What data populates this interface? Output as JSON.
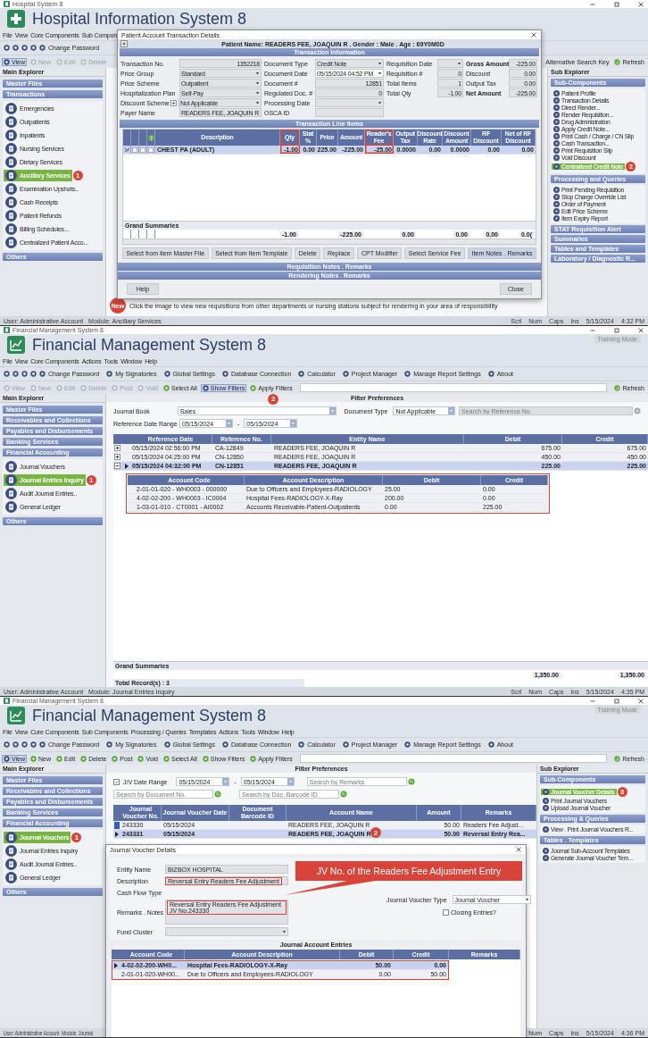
{
  "screens": [
    {
      "kind": "hospital",
      "window_title": "Hospital System 8",
      "app_title": "Hospital Information System 8",
      "menu": [
        "File",
        "View",
        "Core Components",
        "Sub Compon"
      ],
      "toolbar": [
        "Change Password"
      ],
      "actions": [
        {
          "label": "View",
          "selected": true,
          "disabled": false
        },
        {
          "label": "New",
          "selected": false,
          "disabled": true
        },
        {
          "label": "Edit",
          "selected": false,
          "disabled": true
        },
        {
          "label": "Delete",
          "selected": false,
          "disabled": true
        }
      ],
      "search_label": "Alternative Search Key",
      "refresh": "Refresh",
      "main_explorer": {
        "title": "Main Explorer",
        "sections": [
          {
            "label": "Master Files"
          },
          {
            "label": "Transactions",
            "items": [
              {
                "label": "Emergencies",
                "selected": false
              },
              {
                "label": "Outpatients",
                "selected": false
              },
              {
                "label": "Inpatients",
                "selected": false
              },
              {
                "label": "Nursing Services",
                "selected": false
              },
              {
                "label": "Dietary Services",
                "selected": false
              },
              {
                "label": "Ancillary Services",
                "selected": true,
                "badge": "1"
              },
              {
                "label": "Examination Upshots..",
                "selected": false
              },
              {
                "label": "Cash Receipts",
                "selected": false
              },
              {
                "label": "Patient Refunds",
                "selected": false
              },
              {
                "label": "Billing Schedules...",
                "selected": false
              },
              {
                "label": "Centralized Patient Acco...",
                "selected": false
              }
            ]
          },
          {
            "label": "Others"
          }
        ]
      },
      "sub_explorer": {
        "title": "Sub Explorer",
        "sections": [
          {
            "label": "Sub-Components",
            "items": [
              {
                "label": "Patient Profile",
                "selected": false
              },
              {
                "label": "Transaction Details",
                "selected": false
              },
              {
                "label": "Direct Render...",
                "selected": false
              },
              {
                "label": "Render Requisition...",
                "selected": false
              },
              {
                "label": "Drug Administration",
                "selected": false
              },
              {
                "label": "Apply Credit Note...",
                "selected": false
              },
              {
                "label": "Print Cash / Charge / CN Slip",
                "selected": false
              },
              {
                "label": "Cash Transaction...",
                "selected": false
              },
              {
                "label": "Print Requisition Slip",
                "selected": false
              },
              {
                "label": "Void Discount",
                "selected": false
              },
              {
                "label": "Centralized Credit Note",
                "selected": true,
                "badge": "2"
              }
            ]
          },
          {
            "label": "Processing and Queries",
            "items": [
              {
                "label": "Print Pending Requisition",
                "selected": false
              },
              {
                "label": "Stop Charge Override List",
                "selected": false
              },
              {
                "label": "Order of Payment",
                "selected": false
              },
              {
                "label": "Edit Price Scheme",
                "selected": false
              },
              {
                "label": "Item Expiry Report",
                "selected": false
              }
            ]
          },
          {
            "label": "STAT Requisition Alert"
          },
          {
            "label": "Summaries"
          },
          {
            "label": "Tables and Templates"
          },
          {
            "label": "Laboratory / Diagnostic R..."
          }
        ]
      },
      "notice": {
        "badge": "New",
        "text": "Click the image to view new requisitions from other departments or nursing stations subject for rendering in your area of responsibility"
      },
      "status": {
        "left": [
          "User: Administrative Account",
          "Module: Ancillary Services"
        ],
        "right": [
          "Scrl",
          "Num",
          "Caps",
          "Ins",
          "5/15/2024",
          "4:32 PM"
        ]
      },
      "dialog": {
        "title": "Patient Account Transaction Details",
        "patient": "Patient Name: READERS FEE, JOAQUIN R . Gender : Male . Age : 69Y0M0D",
        "info_title": "Transaction Information",
        "form": [
          [
            {
              "label": "Transaction No.",
              "value": "1352218",
              "kind": "number"
            },
            {
              "label": "Price Group",
              "value": "Standard",
              "kind": "dropdown"
            },
            {
              "label": "Price Scheme",
              "value": "Outpatient",
              "kind": "dropdown"
            },
            {
              "label": "Hospitalization Plan",
              "value": "Self-Pay",
              "kind": "dropdown"
            },
            {
              "label": "Discount Scheme",
              "value": "Not Applicable",
              "kind": "dropdown",
              "add_button": true
            },
            {
              "label": "Payer Name",
              "value": "READERS FEE, JOAQUIN R",
              "kind": "text"
            }
          ],
          [
            {
              "label": "Document Type",
              "value": "Credit Note",
              "kind": "dropdown"
            },
            {
              "label": "Document Date",
              "value": "05/15/2024 04:52 PM",
              "kind": "date"
            },
            {
              "label": "Document #",
              "value": "12851",
              "kind": "number"
            },
            {
              "label": "Regulated Doc. #",
              "value": "0",
              "kind": "number"
            },
            {
              "label": "Processing Date",
              "kind": "dropdown"
            },
            {
              "label": "OSCA ID",
              "kind": "text"
            }
          ],
          [
            {
              "label": "Requisition Date",
              "kind": "dropdown"
            },
            {
              "label": "Requisition #",
              "value": "0",
              "kind": "number"
            },
            {
              "label": "Total Items",
              "value": "1",
              "kind": "number"
            },
            {
              "label": "Total Qty",
              "value": "-1.00",
              "kind": "number"
            }
          ],
          [
            {
              "label": "Gross Amount",
              "value": "-225.00",
              "kind": "number",
              "bold": true
            },
            {
              "label": "Discount",
              "value": "0.00",
              "kind": "number",
              "bold": false
            },
            {
              "label": "Output Tax",
              "value": "0.00",
              "kind": "number",
              "bold": false
            },
            {
              "label": "Net Amount",
              "value": "-225.00",
              "kind": "number",
              "bold": true
            }
          ]
        ],
        "items_title": "Transaction Line Items",
        "grid": {
          "columns": [
            {
              "label": "Description"
            },
            {
              "label": "Qty",
              "highlighted": true
            },
            {
              "label": "Stat %",
              "highlighted": false
            },
            {
              "label": "Price",
              "highlighted": false
            },
            {
              "label": "Amount",
              "highlighted": false
            },
            {
              "label": "Reader's Fee",
              "highlighted": true
            },
            {
              "label": "Output Tax",
              "highlighted": false
            },
            {
              "label": "Discount Rate",
              "highlighted": false
            },
            {
              "label": "Discount Amount",
              "highlighted": false
            },
            {
              "label": "RF Discount",
              "highlighted": false
            },
            {
              "label": "Net of RF Discount",
              "highlighted": false
            }
          ],
          "rows": [
            {
              "checks": [
                false,
                false,
                false
              ],
              "cells": [
                "CHEST PA (ADULT)",
                "-1.00",
                "0.00",
                "225.00",
                "-225.00",
                "-25.00",
                "0.0000",
                "0.00",
                "0.0000",
                "0.00",
                "0.00"
              ]
            }
          ],
          "summary_label": "Grand Summaries",
          "summary_values": [
            "-1.00",
            "-225.00",
            "0.00",
            "0.00",
            "0.00",
            "0.0("
          ]
        },
        "buttons": [
          "Select from Item Master File",
          "Select from Item Template",
          "Delete",
          "Replace",
          "CPT Modifier",
          "Select Service Fee",
          "Item Notes . Remarks"
        ],
        "bars": [
          "Requisition Notes . Remarks",
          "Rendering Notes . Remarks"
        ],
        "help": "Help",
        "close": "Close"
      }
    },
    {
      "kind": "inquiry",
      "window_title": "Financial Management System 8",
      "app_title": "Financial Management System 8",
      "training_mode": "Training Mode",
      "menu": [
        "File",
        "View",
        "Core Components",
        "Actions",
        "Tools",
        "Window",
        "Help"
      ],
      "toolbar": [
        "Change Password",
        "My Signatories",
        "Global Settings",
        "Database Connection",
        "Calculator",
        "Project Manager",
        "Manage Report Settings",
        "About"
      ],
      "actions": [
        {
          "label": "View",
          "selected": false,
          "disabled": true
        },
        {
          "label": "New",
          "selected": false,
          "disabled": true
        },
        {
          "label": "Edit",
          "selected": false,
          "disabled": true
        },
        {
          "label": "Delete",
          "selected": false,
          "disabled": true
        },
        {
          "label": "Post",
          "selected": false,
          "disabled": true
        },
        {
          "label": "Void",
          "selected": false,
          "disabled": true
        },
        {
          "label": "Select All",
          "selected": false,
          "disabled": false
        },
        {
          "label": "Show Filters",
          "selected": true,
          "disabled": false
        },
        {
          "label": "Apply Filters",
          "selected": false,
          "disabled": false,
          "badge": "2"
        }
      ],
      "refresh": "Refresh",
      "main_explorer": {
        "title": "Main Explorer",
        "sections": [
          {
            "label": "Master Files"
          },
          {
            "label": "Receivables and Collections"
          },
          {
            "label": "Payables and Disbursements"
          },
          {
            "label": "Banking Services"
          },
          {
            "label": "Financial Accounting",
            "items": [
              {
                "label": "Journal Vouchers",
                "selected": false
              },
              {
                "label": "Journal Entries Inquiry",
                "selected": true,
                "badge": "1"
              },
              {
                "label": "Audit Journal Entries..",
                "selected": false
              },
              {
                "label": "General Ledger",
                "selected": false
              }
            ]
          },
          {
            "label": "Others"
          }
        ]
      },
      "filter": {
        "title": "Filter Preferences",
        "journal_book": {
          "label": "Journal Book",
          "value": "Sales"
        },
        "date_range": {
          "label": "Reference Date Range",
          "from": "05/15/2024",
          "separator": "-",
          "to": "05/15/2024"
        },
        "document_type": {
          "label": "Document Type",
          "value": "Not Applicable"
        },
        "search": {
          "placeholder": "Search by Reference No."
        }
      },
      "grid": {
        "columns": [
          {
            "label": "Reference Date"
          },
          {
            "label": "Reference No."
          },
          {
            "label": "Entity Name"
          },
          {
            "label": "Debit",
            "summary": "1,350.00"
          },
          {
            "label": "Credit",
            "summary": "1,350.00"
          }
        ],
        "rows": [
          {
            "cells": [
              "05/15/2024 02:56:00 PM",
              "CA-12849",
              "READERS FEE, JOAQUIN R",
              "675.00",
              "675.00"
            ],
            "selected": false,
            "expanded": false
          },
          {
            "cells": [
              "05/15/2024 04:25:00 PM",
              "CN-12850",
              "READERS FEE, JOAQUIN R",
              "450.00",
              "450.00"
            ],
            "selected": false,
            "expanded": false
          },
          {
            "cells": [
              "05/15/2024 04:32:00 PM",
              "CN-12851",
              "READERS FEE, JOAQUIN R",
              "225.00",
              "225.00"
            ],
            "selected": true,
            "expanded": true,
            "details": {
              "highlighted": true,
              "columns": [
                "Account Code",
                "Account Description",
                "Debit",
                "Credit"
              ],
              "rows": [
                [
                  "2-01-01-020 - WH0003 - 000000",
                  "Due to Officers and  Employees-RADIOLOGY",
                  "25.00",
                  "0.00"
                ],
                [
                  "4-02-02-200 - WH0003 - IC0004",
                  "Hospital  Fees-RADIOLOGY-X-Ray",
                  "200.00",
                  "0.00"
                ],
                [
                  "1-03-01-010 - CT0001 - AI0002",
                  "Accounts  Receivable-Patient-Outpatients",
                  "0.00",
                  "225.00"
                ]
              ]
            }
          }
        ],
        "summary_label": "Grand Summaries",
        "total": "Total Record(s) : 3"
      },
      "status": {
        "left": [
          "User: Administrative Account",
          "Module: Journal Entries Inquiry"
        ],
        "right": [
          "Scrl",
          "Num",
          "Caps",
          "Ins",
          "5/15/2024",
          "4:35 PM"
        ]
      }
    },
    {
      "kind": "vouchers",
      "window_title": "Financial Management System 8",
      "app_title": "Financial Management System 8",
      "training_mode": "Training Mode",
      "menu": [
        "File",
        "View",
        "Core Components",
        "Sub Components",
        "Processing / Queries",
        "Templates",
        "Actions",
        "Tools",
        "Window",
        "Help"
      ],
      "toolbar": [
        "Change Password",
        "My Signatories",
        "Global Settings",
        "Database Connection",
        "Calculator",
        "Project Manager",
        "Manage Report Settings",
        "About"
      ],
      "actions": [
        {
          "label": "View",
          "selected": true,
          "disabled": false
        },
        {
          "label": "New",
          "selected": false,
          "disabled": false
        },
        {
          "label": "Edit",
          "selected": false,
          "disabled": false
        },
        {
          "label": "Delete",
          "selected": false,
          "disabled": false
        },
        {
          "label": "Post",
          "selected": false,
          "disabled": false
        },
        {
          "label": "Void",
          "selected": false,
          "disabled": false
        },
        {
          "label": "Select All",
          "selected": false,
          "disabled": false
        },
        {
          "label": "Show Filters",
          "selected": false,
          "disabled": false
        },
        {
          "label": "Apply Filters",
          "selected": false,
          "disabled": false
        }
      ],
      "refresh": "Refresh",
      "main_explorer": {
        "title": "Main Explorer",
        "sections": [
          {
            "label": "Master Files"
          },
          {
            "label": "Receivables and Collections"
          },
          {
            "label": "Payables and Disbursements"
          },
          {
            "label": "Banking Services"
          },
          {
            "label": "Financial Accounting",
            "items": [
              {
                "label": "Journal Vouchers",
                "selected": true,
                "badge": "1"
              },
              {
                "label": "Journal Entries Inquiry",
                "selected": false
              },
              {
                "label": "Audit Journal Entries..",
                "selected": false
              },
              {
                "label": "General Ledger",
                "selected": false
              }
            ]
          },
          {
            "label": "Others"
          }
        ]
      },
      "sub_explorer": {
        "title": "Sub Explorer",
        "sections": [
          {
            "label": "Sub-Components",
            "items": [
              {
                "label": "Journal Voucher Details",
                "selected": true,
                "badge": "3"
              },
              {
                "label": "Print Journal Vouchers",
                "selected": false
              },
              {
                "label": "Upload Journal Voucher",
                "selected": false
              }
            ]
          },
          {
            "label": "Processing & Queries",
            "items": [
              {
                "label": "View . Print Journal Vouchers R...",
                "selected": false
              }
            ]
          },
          {
            "label": "Tables . Templates",
            "items": [
              {
                "label": "Journal Sub-Account Templates",
                "selected": false
              },
              {
                "label": "Generate Journal Voucher Tem...",
                "selected": false
              }
            ]
          }
        ]
      },
      "filter": {
        "title": "Filter Preferences",
        "date_range": {
          "label": "J/V Date Range",
          "checked": true,
          "from": "05/15/2024",
          "separator": "-",
          "to": "05/15/2024"
        },
        "searches": [
          {
            "placeholder": "Search by Remarks"
          },
          {
            "placeholder": "Search by Document No."
          },
          {
            "placeholder": "Search by Doc. Barcode ID"
          }
        ]
      },
      "grid": {
        "columns": [
          "Journal Voucher No.",
          "Journal Voucher Date",
          "Document Barcode ID",
          "Account Name",
          "Amount",
          "Remarks"
        ],
        "rows": [
          {
            "cells": [
              "243330",
              "05/15/2024",
              "",
              "READERS FEE, JOAQUIN R",
              "50.00",
              "Readers Fee Adjust..."
            ],
            "selected": false
          },
          {
            "cells": [
              "243331",
              "05/15/2024",
              "",
              "READERS FEE, JOAQUIN R",
              "50.00",
              "Reversal Entry Rea..."
            ],
            "selected": true,
            "badge": "2"
          }
        ]
      },
      "status": {
        "left": [
          "User: Administrative Account",
          "Module: Journal"
        ],
        "right": [
          "Num",
          "Caps",
          "Ins",
          "5/15/2024",
          "4:36 PM"
        ]
      },
      "dialog": {
        "title": "Journal Voucher Details",
        "form": [
          {
            "label": "Entity Name",
            "value": "BIZBOX HOSPITAL",
            "kind": "text",
            "highlighted": false
          },
          {
            "label": "Description",
            "value": "Reversal Entry Readers Fee Adjustment",
            "kind": "text",
            "highlighted": true
          },
          {
            "label": "Cash Flow Type",
            "kind": "blank"
          },
          {
            "label": "Remarks . Notes",
            "value": "Reversal Entry Readers Fee Adjustment JV No.243330",
            "kind": "textarea",
            "highlighted": true
          },
          {
            "label": "Fund Cluster",
            "kind": "dropdown"
          }
        ],
        "voucher_type": {
          "label": "Journal Voucher Type",
          "value": "Journal Voucher"
        },
        "closing": {
          "label": "Closing Entries?",
          "checked": false
        },
        "callout": "JV No. of the Readers Fee Adjustment Entry",
        "entries_title": "Journal Account Entries",
        "entries": {
          "highlighted": true,
          "columns": [
            "Account Code",
            "Account Description",
            "Debit",
            "Credit",
            "Remarks"
          ],
          "rows": [
            {
              "cells": [
                "4-02-02-200-WH0...",
                "Hospital  Fees-RADIOLOGY-X-Ray",
                "50.00",
                "0.00"
              ],
              "selected": true
            },
            {
              "cells": [
                "2-01-01-020-WH00...",
                "Due to Officers and  Employees-RADIOLOGY",
                "0.00",
                "50.00"
              ],
              "selected": false
            }
          ]
        }
      }
    }
  ]
}
